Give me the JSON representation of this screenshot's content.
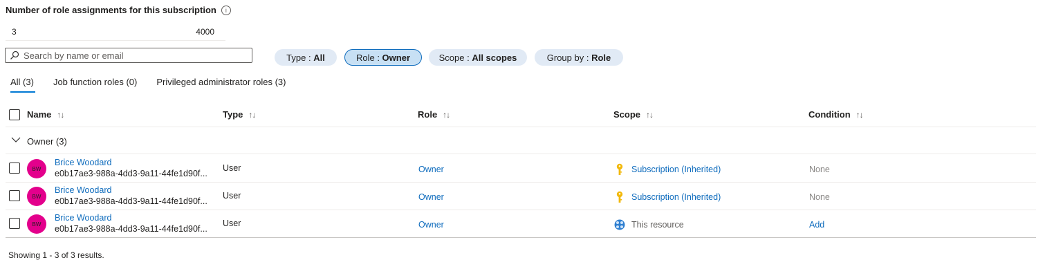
{
  "title": "Number of role assignments for this subscription",
  "info_icon": "info-icon",
  "count": {
    "current": "3",
    "max": "4000"
  },
  "search": {
    "placeholder": "Search by name or email",
    "value": ""
  },
  "filters": [
    {
      "label": "Type : ",
      "value": "All"
    },
    {
      "label": "Role : ",
      "value": "Owner"
    },
    {
      "label": "Scope : ",
      "value": "All scopes"
    },
    {
      "label": "Group by : ",
      "value": "Role"
    }
  ],
  "tabs": [
    {
      "label": "All (3)"
    },
    {
      "label": "Job function roles (0)"
    },
    {
      "label": "Privileged administrator roles (3)"
    }
  ],
  "columns": {
    "name": "Name",
    "type": "Type",
    "role": "Role",
    "scope": "Scope",
    "condition": "Condition",
    "sort_glyph": "↑↓"
  },
  "group": {
    "label": "Owner (3)"
  },
  "rows": [
    {
      "initials": "BW",
      "name": "Brice Woodard",
      "id": "e0b17ae3-988a-4dd3-9a11-44fe1d90f...",
      "type": "User",
      "role": "Owner",
      "scope_icon": "key-icon",
      "scope": "Subscription (Inherited)",
      "condition": "None"
    },
    {
      "initials": "BW",
      "name": "Brice Woodard",
      "id": "e0b17ae3-988a-4dd3-9a11-44fe1d90f...",
      "type": "User",
      "role": "Owner",
      "scope_icon": "key-icon",
      "scope": "Subscription (Inherited)",
      "condition": "None"
    },
    {
      "initials": "BW",
      "name": "Brice Woodard",
      "id": "e0b17ae3-988a-4dd3-9a11-44fe1d90f...",
      "type": "User",
      "role": "Owner",
      "scope_icon": "resource-icon",
      "scope": "This resource",
      "condition": "Add"
    }
  ],
  "footer": "Showing 1 - 3 of 3 results.",
  "colors": {
    "link": "#0f6cbd",
    "avatar": "#e3008c",
    "pill": "#e1eaf5",
    "pill_active": "#c7e0f4"
  }
}
